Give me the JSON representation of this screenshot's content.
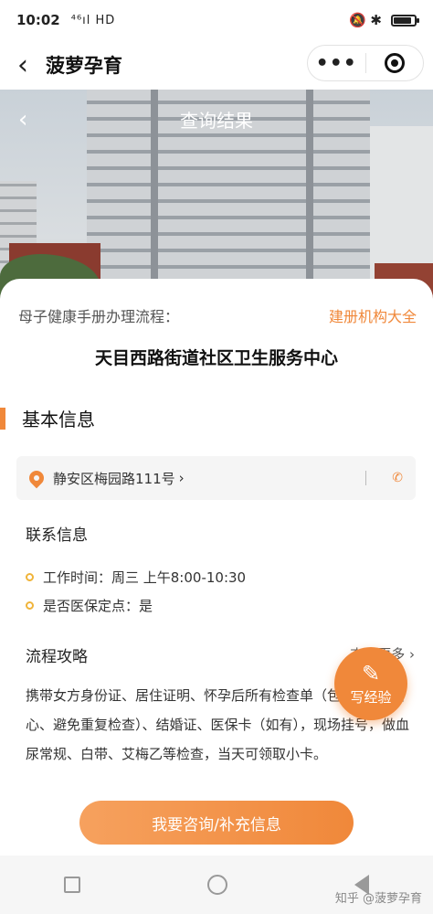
{
  "status_bar": {
    "time": "10:02",
    "network": "⁴⁶ıl HD",
    "icons_right": "🔕 ✱",
    "battery_level": 0.8
  },
  "app_bar": {
    "title": "菠萝孕育",
    "more_glyph": "•••"
  },
  "hero": {
    "title": "查询结果"
  },
  "flow": {
    "label": "母子健康手册办理流程：",
    "link": "建册机构大全"
  },
  "org_name": "天目西路街道社区卫生服务中心",
  "basic_info": {
    "heading": "基本信息",
    "address": "静安区梅园路111号",
    "address_chevron": "›"
  },
  "contact": {
    "heading": "联系信息",
    "hours": "工作时间：周三 上午8:00-10:30",
    "insurance": "是否医保定点：是"
  },
  "guide": {
    "heading": "流程攻略",
    "more": "查看更多 ›",
    "text": "携带女方身份证、居住证明、怀孕后所有检查单（包括B超见胎心、避免重复检查）、结婚证、医保卡（如有），现场挂号，做血尿常规、白带、艾梅乙等检查，当天可领取小卡。"
  },
  "fab_label": "写经验",
  "cta_label": "我要咨询/补充信息",
  "watermark": "知乎 @菠萝孕育",
  "colors": {
    "accent": "#f0883a",
    "dot": "#f0b43a"
  }
}
